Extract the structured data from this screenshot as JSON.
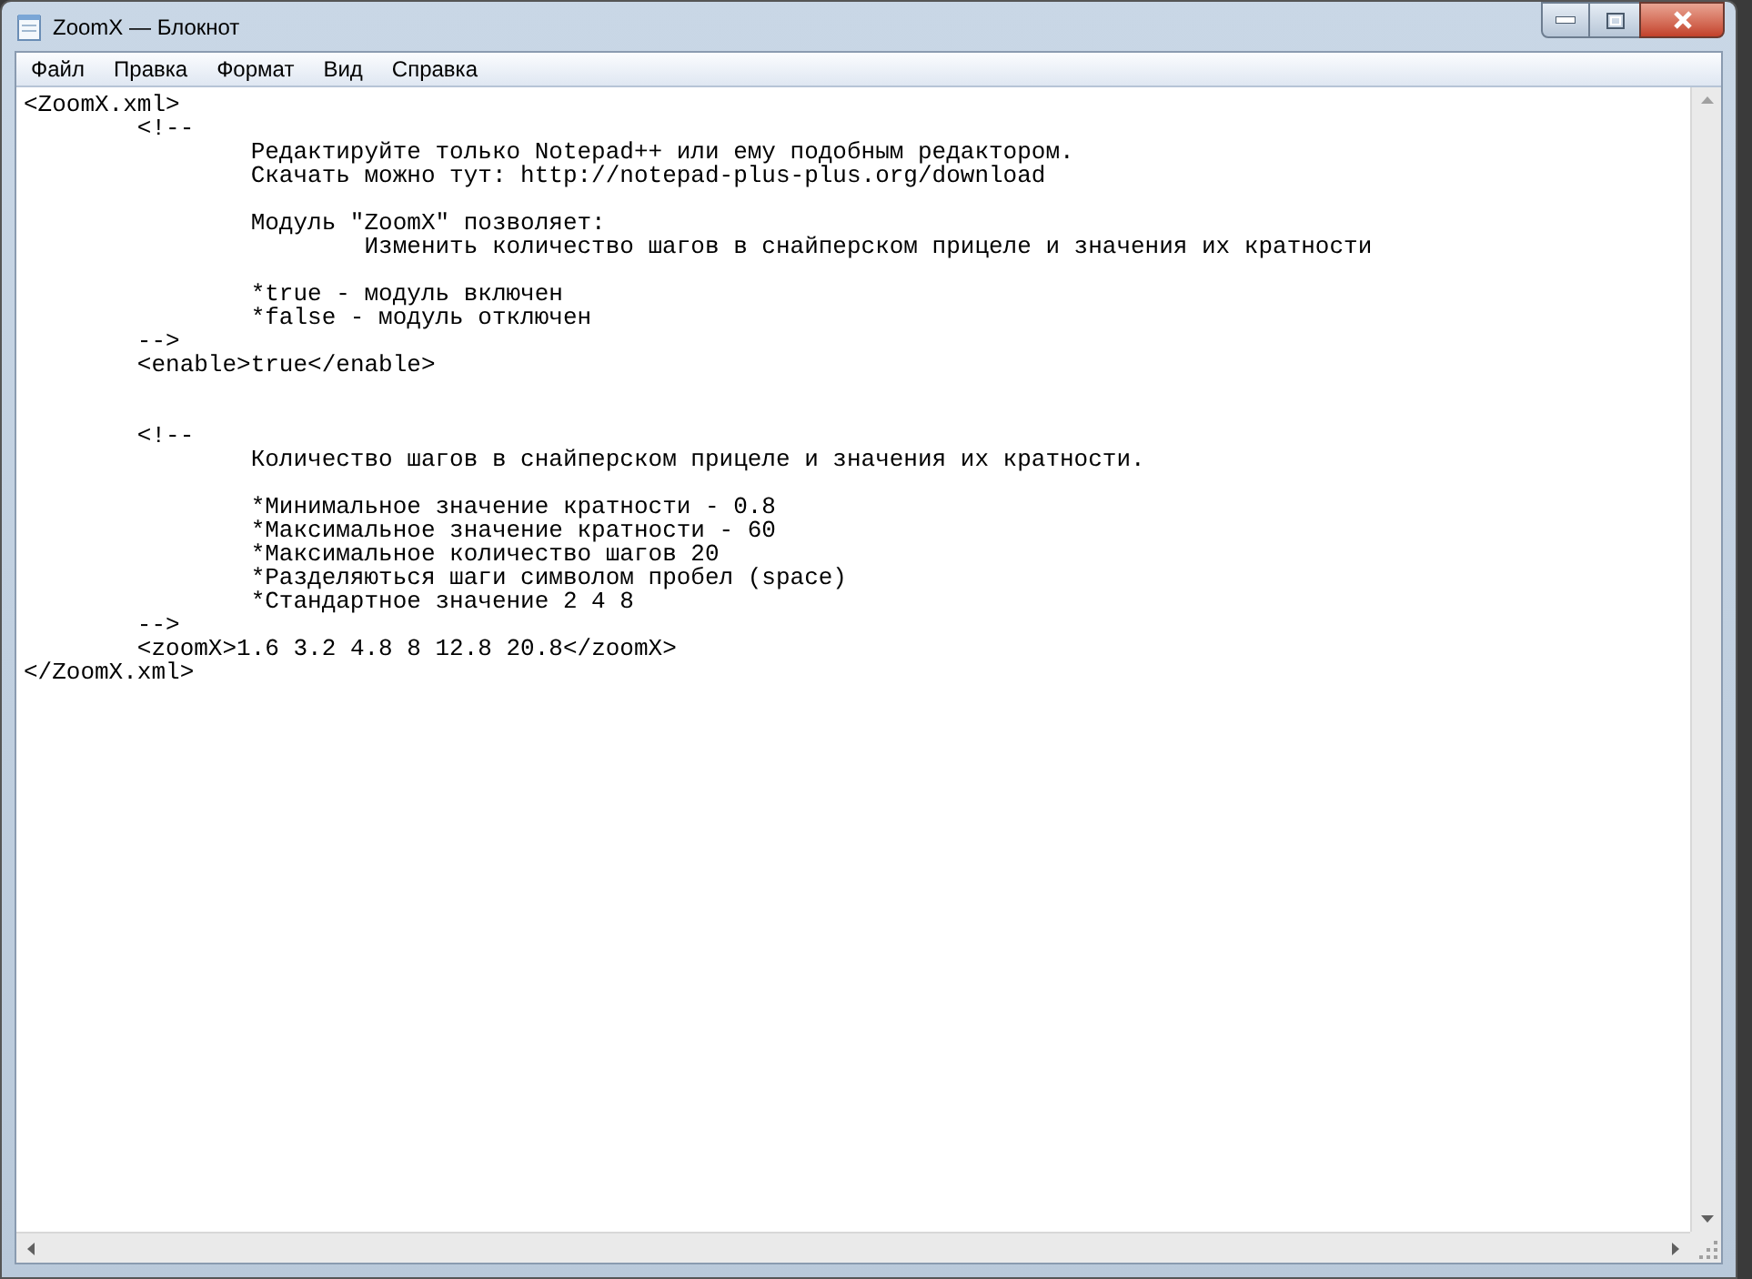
{
  "window": {
    "title": "ZoomX — Блокнот"
  },
  "menu": [
    {
      "label": "Файл"
    },
    {
      "label": "Правка"
    },
    {
      "label": "Формат"
    },
    {
      "label": "Вид"
    },
    {
      "label": "Справка"
    }
  ],
  "editor": {
    "sections": [
      {
        "blocks": [
          {
            "lines": [
              "<ZoomX.xml>",
              "\t<!--",
              "\t\tРедактируйте только Notepad++ или ему подобным редактором.",
              "\t\tСкачать можно тут: http://notepad-plus-plus.org/download"
            ]
          },
          {
            "lines": [
              "\t\tМодуль \"ZoomX\" позволяет:",
              "\t\t\tИзменить количество шагов в снайперском прицеле и значения их кратности"
            ]
          },
          {
            "lines": [
              "\t\t*true - модуль включен",
              "\t\t*false - модуль отключен",
              "\t-->",
              "\t<enable>true</enable>"
            ]
          }
        ]
      },
      {
        "blocks": [
          {
            "lines": [
              "\t<!--",
              "\t\tКоличество шагов в снайперском прицеле и значения их кратности."
            ]
          },
          {
            "lines": [
              "\t\t*Минимальное значение кратности - 0.8",
              "\t\t*Максимальное значение кратности - 60",
              "\t\t*Максимальное количество шагов 20",
              "\t\t*Разделяються шаги символом пробел (space)",
              "\t\t*Стандартное значение 2 4 8",
              "\t-->",
              "\t<zoomX>1.6 3.2 4.8 8 12.8 20.8</zoomX>",
              "</ZoomX.xml>"
            ]
          }
        ]
      }
    ]
  }
}
